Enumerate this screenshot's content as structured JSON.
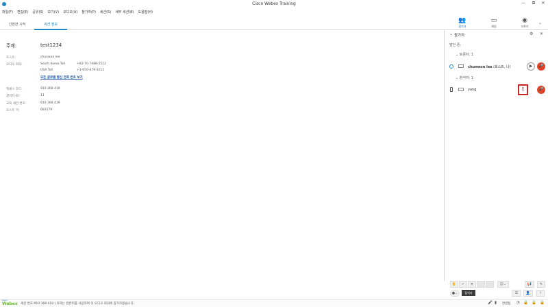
{
  "window": {
    "title": "Cisco Webex Training",
    "controls": [
      "—",
      "⧉",
      "✕"
    ]
  },
  "menu": [
    "파일(F)",
    "편집(E)",
    "공유(S)",
    "보기(V)",
    "오디오(A)",
    "참가자(P)",
    "세션(S)",
    "세부 세션(B)",
    "도움말(H)"
  ],
  "tabs": [
    {
      "label": "간편한 시작",
      "active": false
    },
    {
      "label": "세션 정보",
      "active": true
    }
  ],
  "session": {
    "subject_label": "주제:",
    "subject_value": "test1234",
    "host_label": "호스트:",
    "host_value": "chunwon lee",
    "audio_label": "오디오 회의:",
    "audio_lines": [
      {
        "name": "South Korea Toll",
        "number": "+82-70-7488-5512"
      },
      {
        "name": "USA Toll",
        "number": "+1-650-479-3211"
      }
    ],
    "global_link": "모든 글로벌 발신 전화 번호 보기",
    "access_code_label": "액세스 코드:",
    "access_code_value": "910 368 419",
    "attendee_id_label": "참석자 ID:",
    "attendee_id_value": "11",
    "session_number_label": "교육 세션 번호:",
    "session_number_value": "910 368 419",
    "host_key_label": "호스트 키:",
    "host_key_value": "683179"
  },
  "right_toolbar": [
    {
      "label": "참가자",
      "icon": "participants-icon",
      "glyph": "👥",
      "active": true
    },
    {
      "label": "채팅",
      "icon": "chat-icon",
      "glyph": "▭",
      "active": false
    },
    {
      "label": "녹화기",
      "icon": "record-icon",
      "glyph": "◉",
      "active": false
    }
  ],
  "panel": {
    "title": "참가자",
    "speaking": "발언 중:",
    "presenters_heading": "토론자: 1",
    "attendees_heading": "참석자: 1",
    "presenter": {
      "name": "chunwon lee",
      "role": " (호스트, 나)"
    },
    "attendee": {
      "name": "yang"
    }
  },
  "bottom_tooltip": "참석자",
  "statusbar": {
    "brand": "Webex",
    "brand_small": "Cisco",
    "text": "세션 번호:910 368 419 | 귀하는 컴퓨터를 사용하여 이 오디오 회의에 참가하였습니다.",
    "connection": "연결됨"
  },
  "colors": {
    "accent": "#1e88c7",
    "alert": "#c62828",
    "mic": "#e0452a"
  }
}
